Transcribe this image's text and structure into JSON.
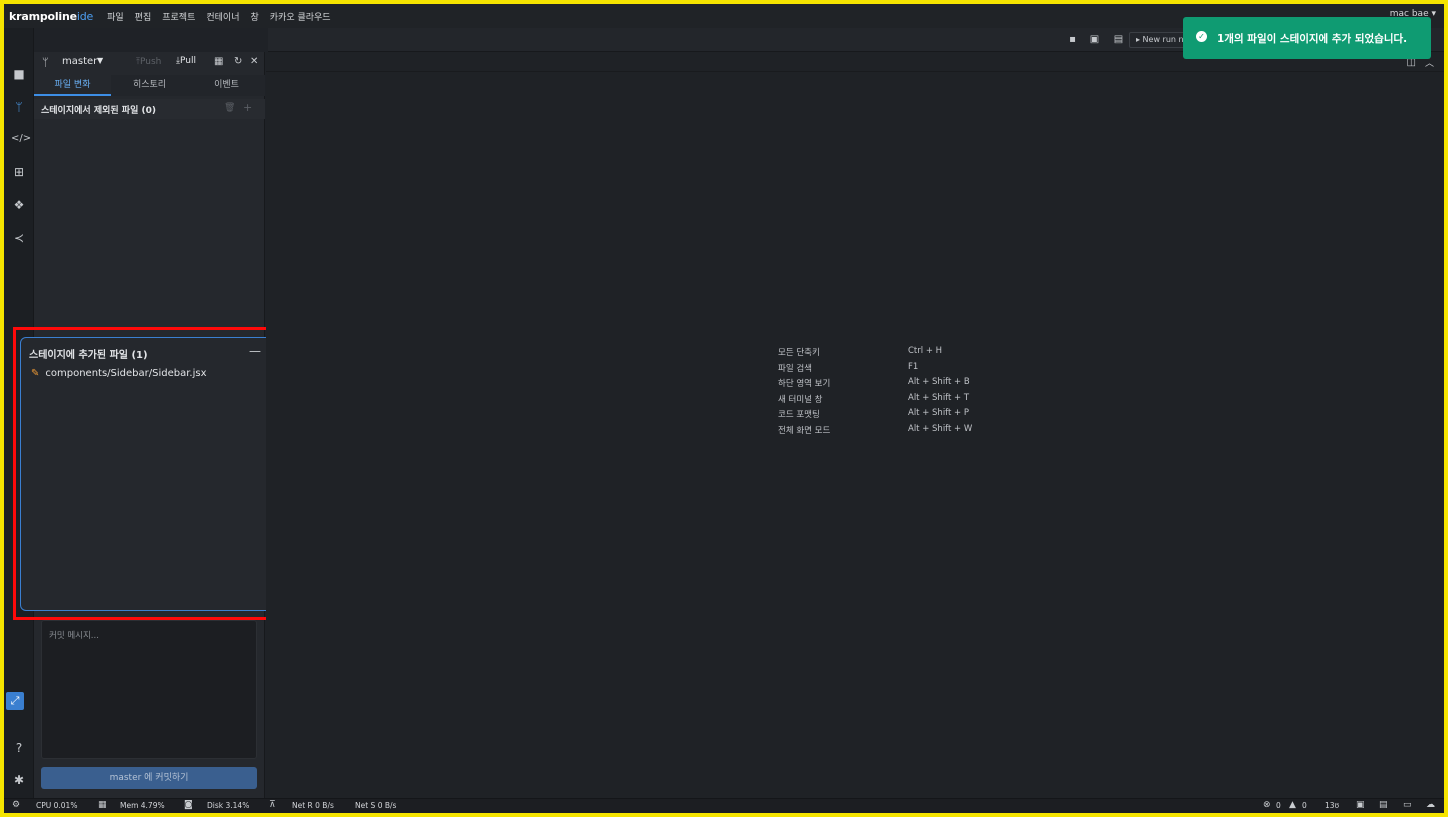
{
  "menubar": {
    "logo_main": "krampoline",
    "logo_accent": "ide",
    "items": [
      "파일",
      "편집",
      "프로젝트",
      "컨테이너",
      "창",
      "카카오 클라우드"
    ],
    "user": "mac bae ▾"
  },
  "toolbar": {
    "run_label": "▸ New run n"
  },
  "toast": {
    "message": "1개의 파일이 스테이지에 추가 되었습니다.",
    "color": "#0f9b72"
  },
  "git": {
    "branch": "master",
    "push_label": "Push",
    "pull_label": "Pull",
    "tabs": [
      {
        "label": "파일 변화",
        "active": true
      },
      {
        "label": "히스토리",
        "active": false
      },
      {
        "label": "이벤트",
        "active": false
      }
    ],
    "unstaged_title": "스테이지에서 제외된 파일 (0)",
    "staged_title": "스테이지에 추가된 파일 (1)",
    "staged_files": [
      "components/Sidebar/Sidebar.jsx"
    ],
    "commit_placeholder": "커밋 메시지...",
    "commit_button": "master 에 커밋하기"
  },
  "shortcuts": [
    {
      "label": "모든 단축키",
      "key": "Ctrl + H"
    },
    {
      "label": "파일 검색",
      "key": "F1"
    },
    {
      "label": "하단 영역 보기",
      "key": "Alt + Shift + B"
    },
    {
      "label": "새 터미널 창",
      "key": "Alt + Shift + T"
    },
    {
      "label": "코드 포맷팅",
      "key": "Alt + Shift + P"
    },
    {
      "label": "전체 화면 모드",
      "key": "Alt + Shift + W"
    }
  ],
  "status": {
    "cpu": "CPU 0.01%",
    "mem": "Mem 4.79%",
    "disk": "Disk 3.14%",
    "net_r": "Net R 0 B/s",
    "net_s": "Net S 0 B/s",
    "errors": "0",
    "warnings": "0",
    "lang": "13ʊ"
  },
  "colors": {
    "accent": "#3d8ee6",
    "highlight": "#ff0a0a",
    "frame": "#f5e400"
  }
}
